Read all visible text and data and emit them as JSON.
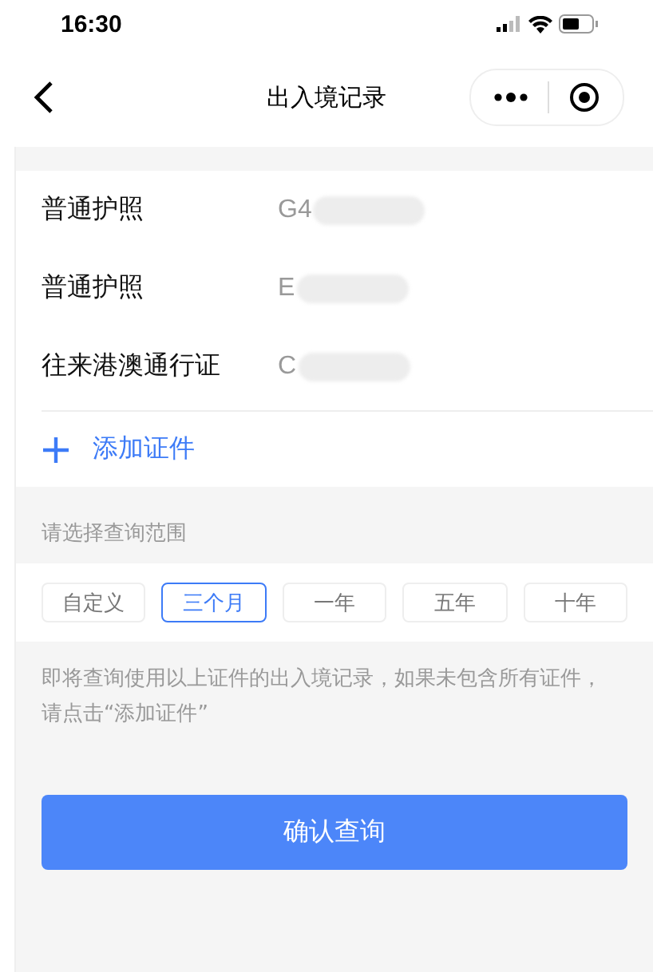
{
  "status_bar": {
    "time": "16:30"
  },
  "nav": {
    "title": "出入境记录"
  },
  "documents": [
    {
      "type": "普通护照",
      "number": "G4"
    },
    {
      "type": "普通护照",
      "number": "E"
    },
    {
      "type": "往来港澳通行证",
      "number": "C"
    }
  ],
  "add_document": {
    "label": "添加证件"
  },
  "range": {
    "label": "请选择查询范围",
    "options": [
      {
        "label": "自定义",
        "selected": false
      },
      {
        "label": "三个月",
        "selected": true
      },
      {
        "label": "一年",
        "selected": false
      },
      {
        "label": "五年",
        "selected": false
      },
      {
        "label": "十年",
        "selected": false
      }
    ]
  },
  "note": "即将查询使用以上证件的出入境记录，如果未包含所有证件，请点击“添加证件”",
  "confirm_button": "确认查询"
}
